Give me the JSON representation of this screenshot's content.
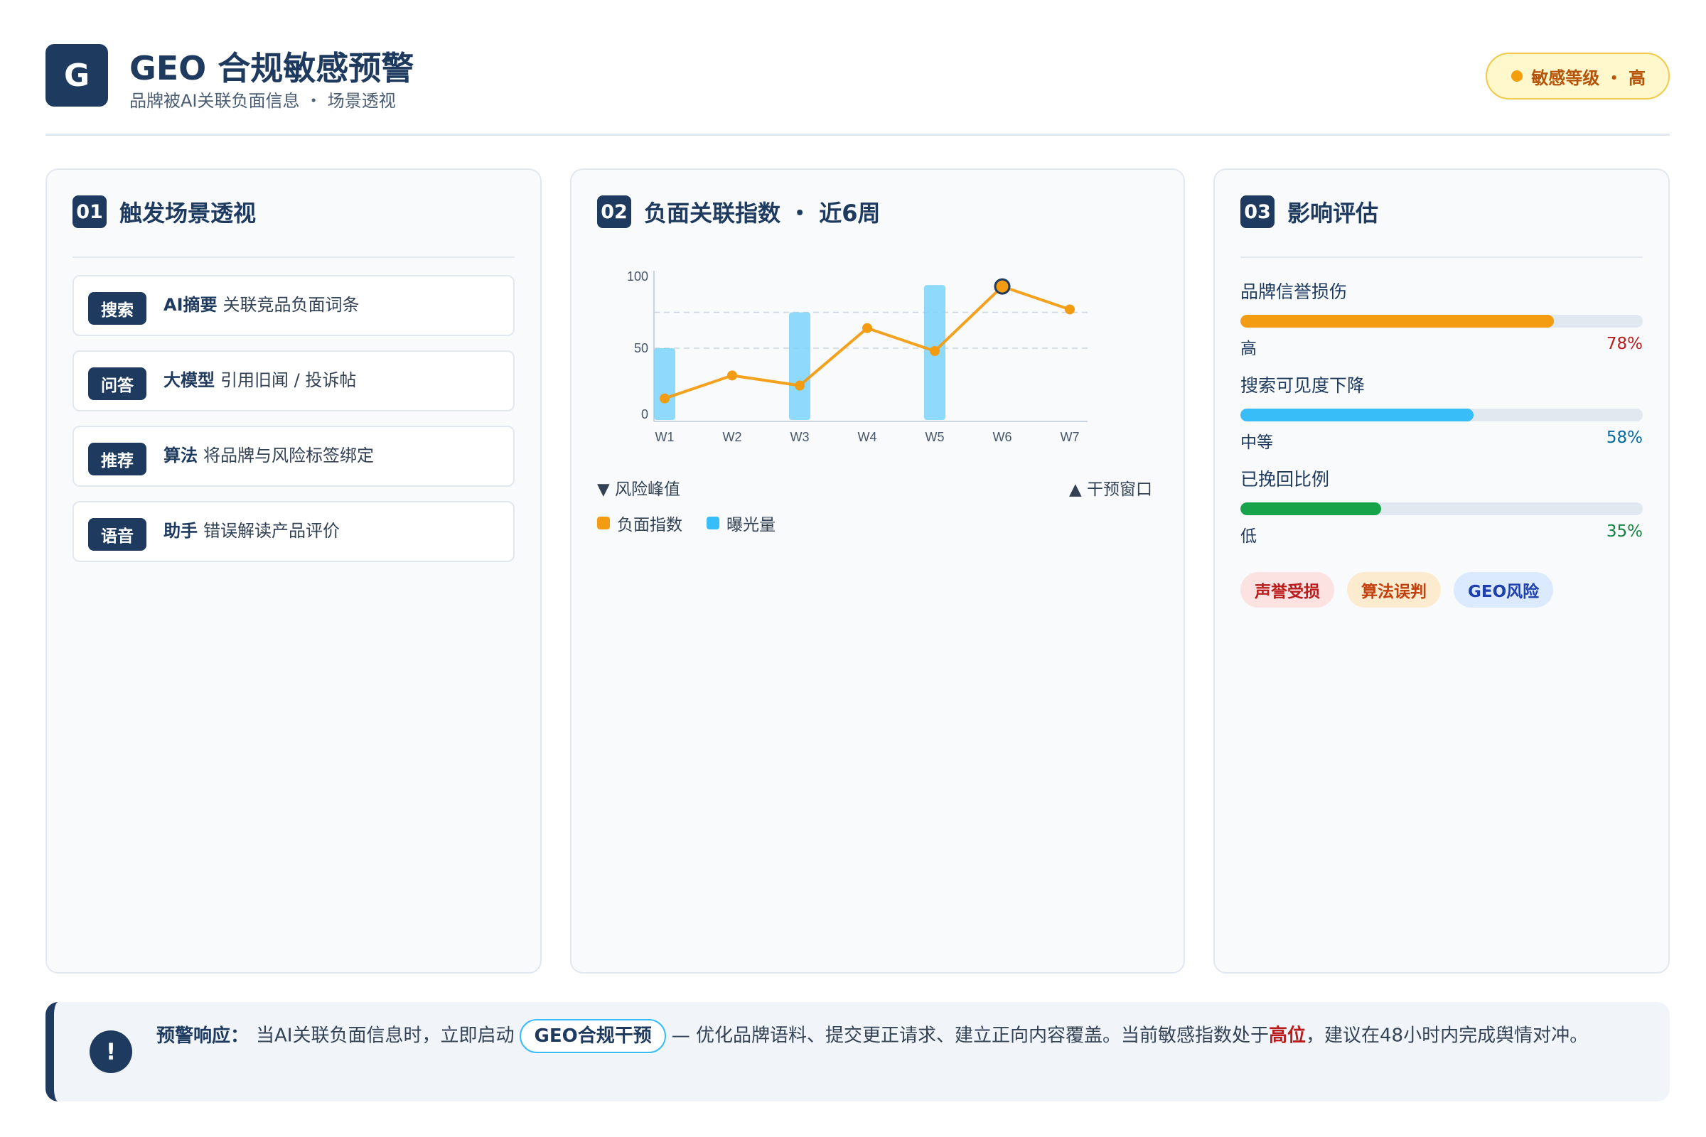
{
  "header": {
    "logo_letter": "G",
    "title": "GEO 合规敏感预警",
    "subtitle": "品牌被AI关联负面信息 ・ 场景透视",
    "level_badge": "敏感等级 ・ 高"
  },
  "colors": {
    "primary": "#1e3a5f",
    "negative_index": "#f39c12",
    "exposure": "#7dd3fc",
    "danger": "#b91c1c",
    "success": "#16a34a",
    "info": "#38bdf8"
  },
  "scenarios": {
    "number": "01",
    "title": "触发场景透视",
    "items": [
      {
        "tag": "搜索",
        "bold": "AI摘要",
        "text": "关联竞品负面词条"
      },
      {
        "tag": "问答",
        "bold": "大模型",
        "text": "引用旧闻 / 投诉帖"
      },
      {
        "tag": "推荐",
        "bold": "算法",
        "text": "将品牌与风险标签绑定"
      },
      {
        "tag": "语音",
        "bold": "助手",
        "text": "错误解读产品评价"
      }
    ]
  },
  "chart": {
    "number": "02",
    "title": "负面关联指数 ・ 近6周",
    "foot_left": "▼ 风险峰值",
    "foot_right": "▲ 干预窗口",
    "legend_line": "负面指数",
    "legend_bar": "曝光量"
  },
  "chart_data": {
    "type": "bar",
    "categories": [
      "W1",
      "W2",
      "W3",
      "W4",
      "W5",
      "W6",
      "W7"
    ],
    "ylim": [
      0,
      100
    ],
    "yticks": [
      0,
      50,
      100
    ],
    "series": [
      {
        "name": "负面指数",
        "type": "line",
        "values": [
          15,
          31,
          24,
          64,
          48,
          93,
          77
        ]
      },
      {
        "name": "曝光量",
        "type": "bar",
        "values": [
          50,
          null,
          75,
          null,
          94,
          null,
          null
        ]
      }
    ],
    "peak_index": 5
  },
  "impact": {
    "number": "03",
    "title": "影响评估",
    "metrics": [
      {
        "label": "品牌信誉损伤",
        "level": "高",
        "percent": "78%",
        "value": 0.78,
        "color": "#f39c12",
        "pct_color": "#b91c1c"
      },
      {
        "label": "搜索可见度下降",
        "level": "中等",
        "percent": "58%",
        "value": 0.58,
        "color": "#38bdf8",
        "pct_color": "#0369a1"
      },
      {
        "label": "已挽回比例",
        "level": "低",
        "percent": "35%",
        "value": 0.35,
        "color": "#16a34a",
        "pct_color": "#15803d"
      }
    ],
    "pills": [
      {
        "label": "声誉受损",
        "bg": "#fde2e2",
        "fg": "#b91c1c"
      },
      {
        "label": "算法误判",
        "bg": "#fdebd0",
        "fg": "#c2410c"
      },
      {
        "label": "GEO风险",
        "bg": "#dbeafe",
        "fg": "#1e40af"
      }
    ]
  },
  "alert": {
    "icon": "!",
    "lead": "预警响应：",
    "text_before": "当AI关联负面信息时，立即启动",
    "chip": "GEO合规干预",
    "text_mid": "— 优化品牌语料、提交更正请求、建立正向内容覆盖。当前敏感指数处于",
    "highlight": "高位",
    "text_after": "，建议在48小时内完成舆情对冲。"
  }
}
